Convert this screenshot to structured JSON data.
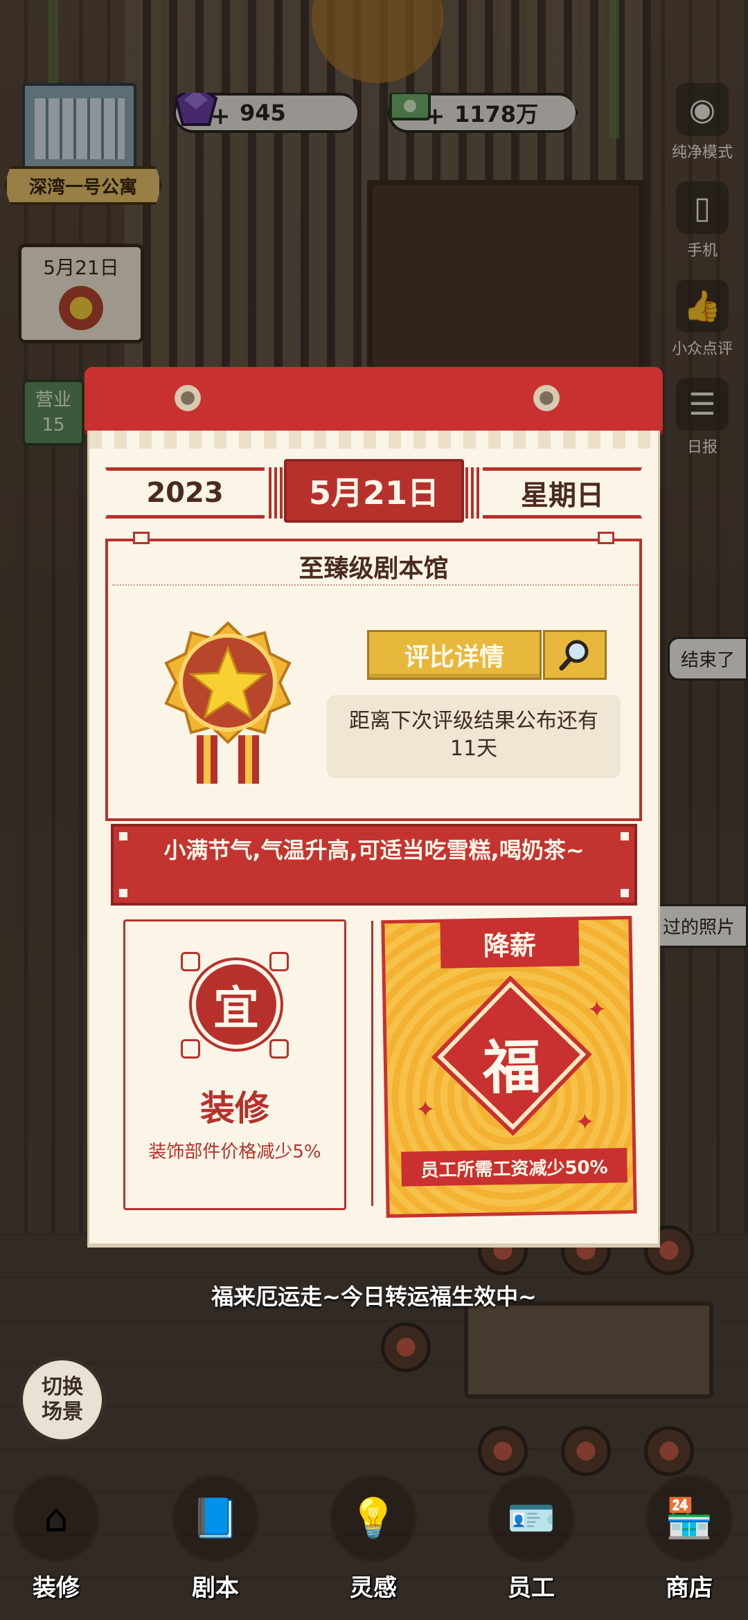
{
  "hud": {
    "apartment": "深湾一号公寓",
    "date_card": "5月21日",
    "open_label": "营业",
    "open_value": "15",
    "gems": "945",
    "cash": "1178万"
  },
  "side": {
    "pure_mode": "纯净模式",
    "phone": "手机",
    "review": "小众点评",
    "daily": "日报",
    "chip1": "结束了",
    "chip2": "过的照片"
  },
  "calendar": {
    "year": "2023",
    "date": "5月21日",
    "weekday": "星期日",
    "rank_title": "至臻级剧本馆",
    "detail_button": "评比详情",
    "next_result": "距离下次评级结果公布还有11天",
    "tip": "小满节气,气温升高,可适当吃雪糕,喝奶茶~",
    "good": {
      "seal": "宜",
      "name": "装修",
      "desc": "装饰部件价格减少5%"
    },
    "luck": {
      "ribbon": "降薪",
      "symbol": "福",
      "effect": "员工所需工资减少50%"
    }
  },
  "toast": "福来厄运走~今日转运福生效中~",
  "switch_scene": "切换\n场景",
  "nav": [
    {
      "label": "装修",
      "icon": "house-icon"
    },
    {
      "label": "剧本",
      "icon": "book-icon"
    },
    {
      "label": "灵感",
      "icon": "bulb-icon"
    },
    {
      "label": "员工",
      "icon": "badge-icon"
    },
    {
      "label": "商店",
      "icon": "shop-icon"
    }
  ]
}
